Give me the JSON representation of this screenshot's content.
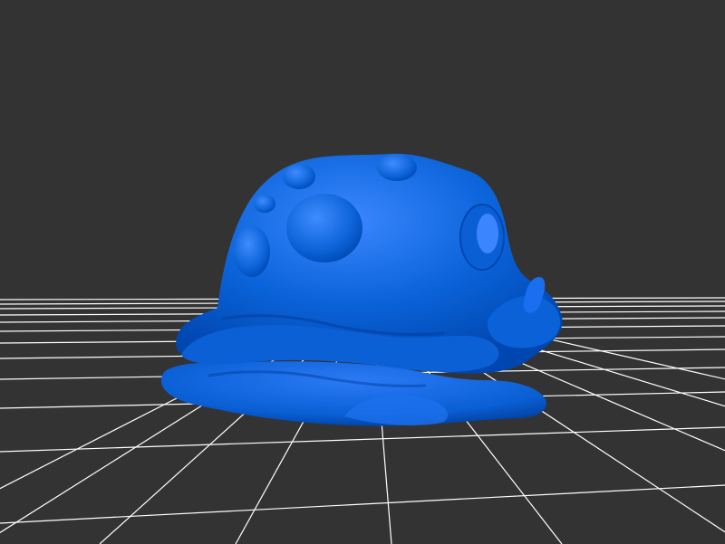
{
  "viewport": {
    "background": "#333333",
    "grid_color": "#ffffff",
    "model_color": "#0a66dd",
    "model_shadow": "#003a9e",
    "model_highlight": "#4b93ff"
  },
  "model": {
    "icon": "blob-creature-model",
    "material": "solid blue"
  }
}
